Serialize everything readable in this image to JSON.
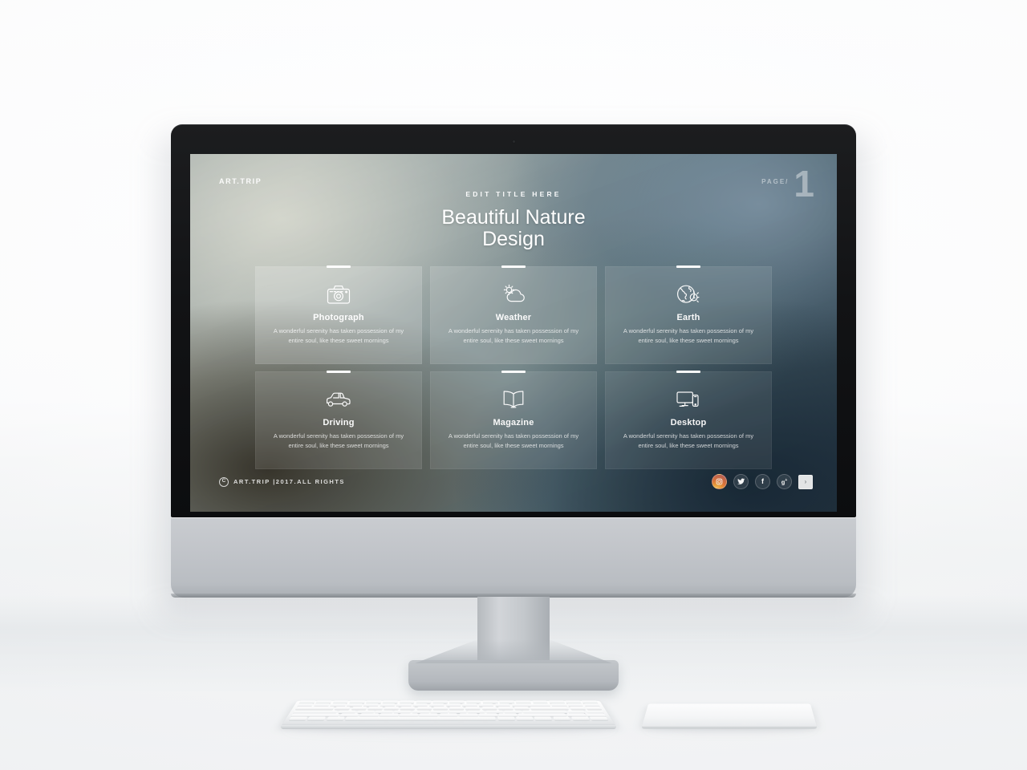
{
  "slide": {
    "brand": "ART.TRIP",
    "page_label": "PAGE/",
    "page_number": "1",
    "eyebrow": "EDIT TITLE HERE",
    "headline_line1": "Beautiful Nature",
    "headline_line2": "Design",
    "body_text": "A wonderful serenity has taken possession of my entire soul, like these sweet mornings",
    "cards": [
      {
        "icon": "camera-icon",
        "title": "Photograph",
        "body": "A wonderful serenity has taken possession of my entire soul, like these sweet mornings"
      },
      {
        "icon": "sun-cloud-icon",
        "title": "Weather",
        "body": "A wonderful serenity has taken possession of my entire soul, like these sweet mornings"
      },
      {
        "icon": "globe-icon",
        "title": "Earth",
        "body": "A wonderful serenity has taken possession of my entire soul, like these sweet mornings"
      },
      {
        "icon": "car-icon",
        "title": "Driving",
        "body": "A wonderful serenity has taken possession of my entire soul, like these sweet mornings"
      },
      {
        "icon": "open-book-icon",
        "title": "Magazine",
        "body": "A wonderful serenity has taken possession of my entire soul, like these sweet mornings"
      },
      {
        "icon": "monitor-phone-icon",
        "title": "Desktop",
        "body": "A wonderful serenity has taken possession of my entire soul, like these sweet mornings"
      }
    ],
    "footer": {
      "copyright_mark": "C",
      "copyright_text": "ART.TRIP |2017.ALL RIGHTS",
      "socials": [
        {
          "name": "instagram-icon",
          "label": ""
        },
        {
          "name": "twitter-icon",
          "label": ""
        },
        {
          "name": "facebook-icon",
          "label": "f"
        },
        {
          "name": "google-plus-icon",
          "label": "g+"
        },
        {
          "name": "next-slide-icon",
          "label": "›"
        }
      ]
    }
  },
  "colors": {
    "accent_white": "#ffffff",
    "screen_dark": "#2c3d49",
    "screen_light": "#aeb5b0",
    "bezel": "#121315",
    "chin": "#c2c5ca",
    "instagram": "#e4793c"
  }
}
